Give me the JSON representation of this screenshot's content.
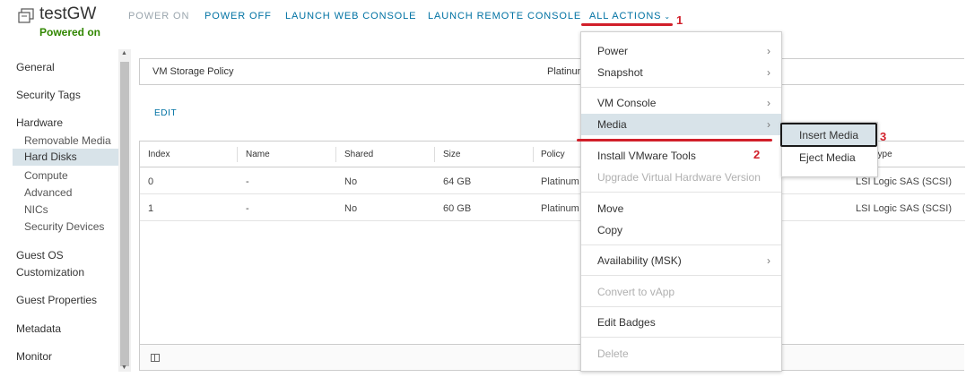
{
  "header": {
    "title": "testGW",
    "status": "Powered on",
    "actions": [
      {
        "label": "POWER ON",
        "enabled": false
      },
      {
        "label": "POWER OFF",
        "enabled": true
      },
      {
        "label": "LAUNCH WEB CONSOLE",
        "enabled": true
      },
      {
        "label": "LAUNCH REMOTE CONSOLE",
        "enabled": true
      },
      {
        "label": "ALL ACTIONS",
        "enabled": true
      }
    ],
    "caret": "⌄"
  },
  "sidebar": {
    "groups": [
      {
        "label": "General"
      },
      {
        "label": "Security Tags"
      },
      {
        "label": "Hardware"
      },
      {
        "label": "Guest OS Customization"
      },
      {
        "label": "Guest Properties"
      },
      {
        "label": "Metadata"
      },
      {
        "label": "Monitor"
      }
    ],
    "hardware_items": [
      "Removable Media",
      "Hard Disks",
      "Compute",
      "Advanced",
      "NICs",
      "Security Devices"
    ],
    "active_item": "Hard Disks",
    "guest_os_line1": "Guest OS",
    "guest_os_line2": "Customization"
  },
  "main": {
    "policy_label": "VM Storage Policy",
    "policy_value": "Platinum",
    "edit_label": "EDIT",
    "columns": [
      "Index",
      "Name",
      "Shared",
      "Size",
      "Policy",
      "Type"
    ],
    "rows": [
      {
        "index": "0",
        "name": "-",
        "shared": "No",
        "size": "64 GB",
        "policy": "Platinum",
        "type": "LSI Logic SAS (SCSI)"
      },
      {
        "index": "1",
        "name": "-",
        "shared": "No",
        "size": "60 GB",
        "policy": "Platinum",
        "type": "LSI Logic SAS (SCSI)"
      }
    ]
  },
  "menu": {
    "items": [
      {
        "label": "Power",
        "submenu": true,
        "enabled": true
      },
      {
        "label": "Snapshot",
        "submenu": true,
        "enabled": true
      },
      {
        "label": "VM Console",
        "submenu": true,
        "enabled": true
      },
      {
        "label": "Media",
        "submenu": true,
        "enabled": true,
        "highlighted": true
      },
      {
        "label": "Install VMware Tools",
        "submenu": false,
        "enabled": true
      },
      {
        "label": "Upgrade Virtual Hardware Version",
        "submenu": false,
        "enabled": false
      },
      {
        "label": "Move",
        "submenu": false,
        "enabled": true
      },
      {
        "label": "Copy",
        "submenu": false,
        "enabled": true
      },
      {
        "label": "Availability (MSK)",
        "submenu": true,
        "enabled": true
      },
      {
        "label": "Convert to vApp",
        "submenu": false,
        "enabled": false
      },
      {
        "label": "Edit Badges",
        "submenu": false,
        "enabled": true
      },
      {
        "label": "Delete",
        "submenu": false,
        "enabled": false
      }
    ],
    "arrow": "›"
  },
  "submenu": {
    "items": [
      {
        "label": "Insert Media",
        "highlighted": true
      },
      {
        "label": "Eject Media",
        "highlighted": false
      }
    ]
  },
  "annotations": [
    "1",
    "2",
    "3"
  ],
  "colors": {
    "accent": "#0072a3",
    "status_green": "#318700",
    "annotation_red": "#d11f2a",
    "highlight": "#d8e3e9"
  }
}
